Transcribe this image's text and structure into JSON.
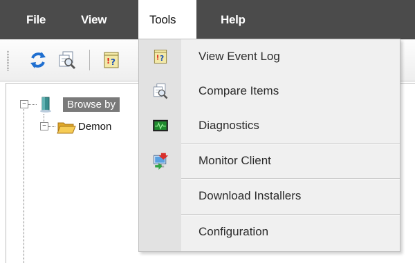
{
  "menubar": {
    "items": [
      {
        "label": "File"
      },
      {
        "label": "View"
      },
      {
        "label": "Tools",
        "active": true
      },
      {
        "label": "Help"
      }
    ]
  },
  "toolbar": {
    "buttons": [
      {
        "icon": "refresh-icon"
      },
      {
        "icon": "compare-icon"
      },
      {
        "icon": "event-log-icon"
      }
    ]
  },
  "tree": {
    "root": {
      "label": "Browse by",
      "icon": "server-icon",
      "expanded": true
    },
    "child": {
      "label": "Demon",
      "icon": "folder-open-icon",
      "expanded": true
    }
  },
  "tools_menu": {
    "items": [
      {
        "label": "View Event Log",
        "icon": "event-log-icon"
      },
      {
        "label": "Compare Items",
        "icon": "compare-icon"
      },
      {
        "label": "Diagnostics",
        "icon": "diagnostics-icon"
      },
      {
        "label": "Monitor Client",
        "icon": "monitor-client-icon"
      },
      {
        "label": "Download Installers",
        "icon": ""
      },
      {
        "label": "Configuration",
        "icon": ""
      }
    ]
  },
  "colors": {
    "menubar_bg": "#4b4b4b",
    "menu_bg": "#f0f0f0",
    "icon_column": "#e2e2e2",
    "selection": "#7a7a7a"
  }
}
